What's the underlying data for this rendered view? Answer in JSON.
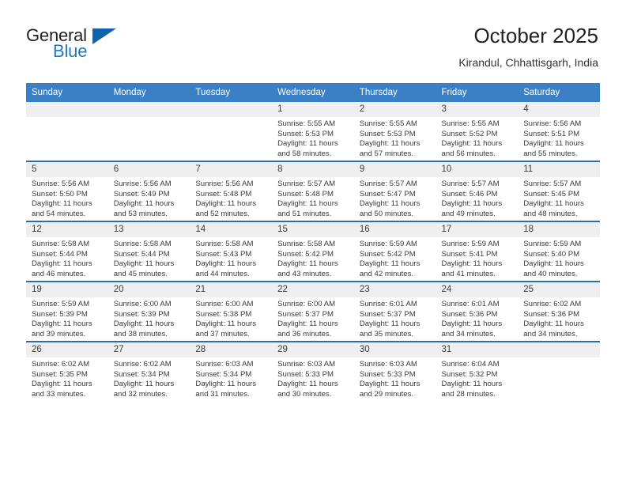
{
  "brand": {
    "name_part1": "General",
    "name_part2": "Blue",
    "triangle_icon": "triangle-icon",
    "accent_color": "#1263ad",
    "blue_text_color": "#1b79c8"
  },
  "header": {
    "month_title": "October 2025",
    "location": "Kirandul, Chhattisgarh, India"
  },
  "calendar": {
    "header_bg": "#3b7fc4",
    "row_divider_color": "#2e6da4",
    "daynum_bg": "#efefef",
    "weekday_headers": [
      "Sunday",
      "Monday",
      "Tuesday",
      "Wednesday",
      "Thursday",
      "Friday",
      "Saturday"
    ],
    "weeks": [
      [
        {
          "day": "",
          "sunrise": "",
          "sunset": "",
          "daylight_line1": "",
          "daylight_line2": ""
        },
        {
          "day": "",
          "sunrise": "",
          "sunset": "",
          "daylight_line1": "",
          "daylight_line2": ""
        },
        {
          "day": "",
          "sunrise": "",
          "sunset": "",
          "daylight_line1": "",
          "daylight_line2": ""
        },
        {
          "day": "1",
          "sunrise": "Sunrise: 5:55 AM",
          "sunset": "Sunset: 5:53 PM",
          "daylight_line1": "Daylight: 11 hours",
          "daylight_line2": "and 58 minutes."
        },
        {
          "day": "2",
          "sunrise": "Sunrise: 5:55 AM",
          "sunset": "Sunset: 5:53 PM",
          "daylight_line1": "Daylight: 11 hours",
          "daylight_line2": "and 57 minutes."
        },
        {
          "day": "3",
          "sunrise": "Sunrise: 5:55 AM",
          "sunset": "Sunset: 5:52 PM",
          "daylight_line1": "Daylight: 11 hours",
          "daylight_line2": "and 56 minutes."
        },
        {
          "day": "4",
          "sunrise": "Sunrise: 5:56 AM",
          "sunset": "Sunset: 5:51 PM",
          "daylight_line1": "Daylight: 11 hours",
          "daylight_line2": "and 55 minutes."
        }
      ],
      [
        {
          "day": "5",
          "sunrise": "Sunrise: 5:56 AM",
          "sunset": "Sunset: 5:50 PM",
          "daylight_line1": "Daylight: 11 hours",
          "daylight_line2": "and 54 minutes."
        },
        {
          "day": "6",
          "sunrise": "Sunrise: 5:56 AM",
          "sunset": "Sunset: 5:49 PM",
          "daylight_line1": "Daylight: 11 hours",
          "daylight_line2": "and 53 minutes."
        },
        {
          "day": "7",
          "sunrise": "Sunrise: 5:56 AM",
          "sunset": "Sunset: 5:48 PM",
          "daylight_line1": "Daylight: 11 hours",
          "daylight_line2": "and 52 minutes."
        },
        {
          "day": "8",
          "sunrise": "Sunrise: 5:57 AM",
          "sunset": "Sunset: 5:48 PM",
          "daylight_line1": "Daylight: 11 hours",
          "daylight_line2": "and 51 minutes."
        },
        {
          "day": "9",
          "sunrise": "Sunrise: 5:57 AM",
          "sunset": "Sunset: 5:47 PM",
          "daylight_line1": "Daylight: 11 hours",
          "daylight_line2": "and 50 minutes."
        },
        {
          "day": "10",
          "sunrise": "Sunrise: 5:57 AM",
          "sunset": "Sunset: 5:46 PM",
          "daylight_line1": "Daylight: 11 hours",
          "daylight_line2": "and 49 minutes."
        },
        {
          "day": "11",
          "sunrise": "Sunrise: 5:57 AM",
          "sunset": "Sunset: 5:45 PM",
          "daylight_line1": "Daylight: 11 hours",
          "daylight_line2": "and 48 minutes."
        }
      ],
      [
        {
          "day": "12",
          "sunrise": "Sunrise: 5:58 AM",
          "sunset": "Sunset: 5:44 PM",
          "daylight_line1": "Daylight: 11 hours",
          "daylight_line2": "and 46 minutes."
        },
        {
          "day": "13",
          "sunrise": "Sunrise: 5:58 AM",
          "sunset": "Sunset: 5:44 PM",
          "daylight_line1": "Daylight: 11 hours",
          "daylight_line2": "and 45 minutes."
        },
        {
          "day": "14",
          "sunrise": "Sunrise: 5:58 AM",
          "sunset": "Sunset: 5:43 PM",
          "daylight_line1": "Daylight: 11 hours",
          "daylight_line2": "and 44 minutes."
        },
        {
          "day": "15",
          "sunrise": "Sunrise: 5:58 AM",
          "sunset": "Sunset: 5:42 PM",
          "daylight_line1": "Daylight: 11 hours",
          "daylight_line2": "and 43 minutes."
        },
        {
          "day": "16",
          "sunrise": "Sunrise: 5:59 AM",
          "sunset": "Sunset: 5:42 PM",
          "daylight_line1": "Daylight: 11 hours",
          "daylight_line2": "and 42 minutes."
        },
        {
          "day": "17",
          "sunrise": "Sunrise: 5:59 AM",
          "sunset": "Sunset: 5:41 PM",
          "daylight_line1": "Daylight: 11 hours",
          "daylight_line2": "and 41 minutes."
        },
        {
          "day": "18",
          "sunrise": "Sunrise: 5:59 AM",
          "sunset": "Sunset: 5:40 PM",
          "daylight_line1": "Daylight: 11 hours",
          "daylight_line2": "and 40 minutes."
        }
      ],
      [
        {
          "day": "19",
          "sunrise": "Sunrise: 5:59 AM",
          "sunset": "Sunset: 5:39 PM",
          "daylight_line1": "Daylight: 11 hours",
          "daylight_line2": "and 39 minutes."
        },
        {
          "day": "20",
          "sunrise": "Sunrise: 6:00 AM",
          "sunset": "Sunset: 5:39 PM",
          "daylight_line1": "Daylight: 11 hours",
          "daylight_line2": "and 38 minutes."
        },
        {
          "day": "21",
          "sunrise": "Sunrise: 6:00 AM",
          "sunset": "Sunset: 5:38 PM",
          "daylight_line1": "Daylight: 11 hours",
          "daylight_line2": "and 37 minutes."
        },
        {
          "day": "22",
          "sunrise": "Sunrise: 6:00 AM",
          "sunset": "Sunset: 5:37 PM",
          "daylight_line1": "Daylight: 11 hours",
          "daylight_line2": "and 36 minutes."
        },
        {
          "day": "23",
          "sunrise": "Sunrise: 6:01 AM",
          "sunset": "Sunset: 5:37 PM",
          "daylight_line1": "Daylight: 11 hours",
          "daylight_line2": "and 35 minutes."
        },
        {
          "day": "24",
          "sunrise": "Sunrise: 6:01 AM",
          "sunset": "Sunset: 5:36 PM",
          "daylight_line1": "Daylight: 11 hours",
          "daylight_line2": "and 34 minutes."
        },
        {
          "day": "25",
          "sunrise": "Sunrise: 6:02 AM",
          "sunset": "Sunset: 5:36 PM",
          "daylight_line1": "Daylight: 11 hours",
          "daylight_line2": "and 34 minutes."
        }
      ],
      [
        {
          "day": "26",
          "sunrise": "Sunrise: 6:02 AM",
          "sunset": "Sunset: 5:35 PM",
          "daylight_line1": "Daylight: 11 hours",
          "daylight_line2": "and 33 minutes."
        },
        {
          "day": "27",
          "sunrise": "Sunrise: 6:02 AM",
          "sunset": "Sunset: 5:34 PM",
          "daylight_line1": "Daylight: 11 hours",
          "daylight_line2": "and 32 minutes."
        },
        {
          "day": "28",
          "sunrise": "Sunrise: 6:03 AM",
          "sunset": "Sunset: 5:34 PM",
          "daylight_line1": "Daylight: 11 hours",
          "daylight_line2": "and 31 minutes."
        },
        {
          "day": "29",
          "sunrise": "Sunrise: 6:03 AM",
          "sunset": "Sunset: 5:33 PM",
          "daylight_line1": "Daylight: 11 hours",
          "daylight_line2": "and 30 minutes."
        },
        {
          "day": "30",
          "sunrise": "Sunrise: 6:03 AM",
          "sunset": "Sunset: 5:33 PM",
          "daylight_line1": "Daylight: 11 hours",
          "daylight_line2": "and 29 minutes."
        },
        {
          "day": "31",
          "sunrise": "Sunrise: 6:04 AM",
          "sunset": "Sunset: 5:32 PM",
          "daylight_line1": "Daylight: 11 hours",
          "daylight_line2": "and 28 minutes."
        },
        {
          "day": "",
          "sunrise": "",
          "sunset": "",
          "daylight_line1": "",
          "daylight_line2": ""
        }
      ]
    ]
  }
}
